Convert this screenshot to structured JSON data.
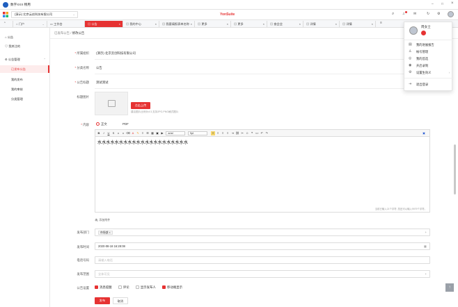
{
  "app": {
    "title": "数字XXX 畅用",
    "brand": "YonSuite"
  },
  "topbar": {
    "org": "(演示) 北京云创科技有限公司",
    "portal": "门户",
    "workbench": "工作台"
  },
  "tabs": [
    {
      "label": "公告",
      "active": true
    },
    {
      "label": "我的中心"
    },
    {
      "label": "我要填报表单名称"
    },
    {
      "label": "更多"
    },
    {
      "label": "更多"
    },
    {
      "label": "查会会"
    },
    {
      "label": "详情"
    },
    {
      "label": "详情"
    }
  ],
  "sidebar": {
    "items": [
      {
        "label": "公告"
      },
      {
        "label": "我关注的"
      },
      {
        "label": "公告管理"
      },
      {
        "label": "已发布公告"
      },
      {
        "label": "我的发布"
      },
      {
        "label": "我的审核"
      },
      {
        "label": "分类管理"
      }
    ]
  },
  "breadcrumb": {
    "parent": "已发布公告",
    "sep": "/",
    "current": "修改公告"
  },
  "form": {
    "org_label": "所属组织",
    "org_value": "(演示) 北京云创科技有限公司",
    "cat_label": "分类名称",
    "cat_value": "公告",
    "title_label": "公告标题",
    "title_value": "测试测试",
    "cover_label": "标题图片",
    "upload_label": "点击上传",
    "upload_hint": "建议图片比例为4:3,支持JPG,PNG格式图片",
    "content_label": "内容",
    "content_opt1": "正文",
    "content_opt2": "PDF",
    "font_name": "arial",
    "font_size": "9pt",
    "editor_text": "水水水水水水水水水水水水水水水水水水水水水",
    "editor_status": "当前已输入21个字符, 您还可以输入9979个字符。",
    "attach_label": "添加附件",
    "dept_label": "发布部门",
    "dept_tag": "市场部",
    "time_label": "发布时间",
    "time_value": "2020-08-18 16:28:08",
    "phone_label": "电话号码",
    "phone_ph": "请输入电话",
    "scope_label": "发布范围",
    "scope_ph": "全体可见",
    "settings_label": "公告设置",
    "opt_remind": "消息提醒",
    "opt_comment": "评论",
    "opt_publisher": "显示发布人",
    "opt_mobile": "移动端显示",
    "publish_btn": "发布",
    "cancel_btn": "取消"
  },
  "user_menu": {
    "name": "周女士",
    "items": [
      {
        "label": "我的进展报告"
      },
      {
        "label": "帐号管理"
      },
      {
        "label": "我的首选"
      },
      {
        "label": "开启录制"
      },
      {
        "label": "设置生效义"
      },
      {
        "label": "退出登录"
      }
    ]
  },
  "colors": {
    "accent": "#e63232",
    "sidebar_active_bg": "#fdecec"
  }
}
